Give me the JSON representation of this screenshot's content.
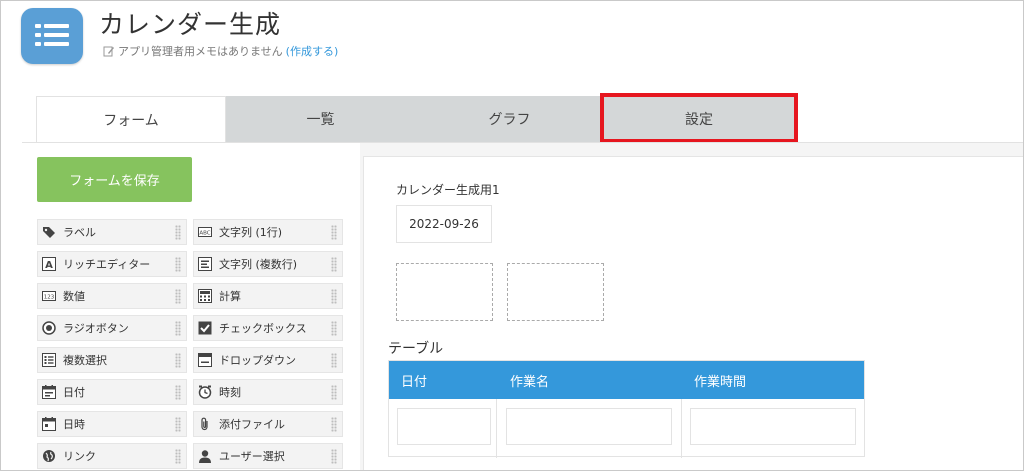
{
  "app": {
    "title": "カレンダー生成",
    "memo_text": "アプリ管理者用メモはありません",
    "memo_link": "(作成する)"
  },
  "tabs": [
    {
      "label": "フォーム",
      "active": true
    },
    {
      "label": "一覧",
      "active": false
    },
    {
      "label": "グラフ",
      "active": false
    },
    {
      "label": "設定",
      "active": false,
      "highlighted": true
    }
  ],
  "palette": {
    "save_label": "フォームを保存",
    "fields": [
      {
        "label": "ラベル",
        "icon": "tag-icon"
      },
      {
        "label": "文字列 (1行)",
        "icon": "abc-text-icon"
      },
      {
        "label": "リッチエディター",
        "icon": "rich-editor-icon"
      },
      {
        "label": "文字列 (複数行)",
        "icon": "multiline-text-icon"
      },
      {
        "label": "数値",
        "icon": "number-icon"
      },
      {
        "label": "計算",
        "icon": "calculator-icon"
      },
      {
        "label": "ラジオボタン",
        "icon": "radio-icon"
      },
      {
        "label": "チェックボックス",
        "icon": "checkbox-icon"
      },
      {
        "label": "複数選択",
        "icon": "multi-select-icon"
      },
      {
        "label": "ドロップダウン",
        "icon": "dropdown-icon"
      },
      {
        "label": "日付",
        "icon": "calendar-icon"
      },
      {
        "label": "時刻",
        "icon": "clock-icon"
      },
      {
        "label": "日時",
        "icon": "datetime-icon"
      },
      {
        "label": "添付ファイル",
        "icon": "paperclip-icon"
      },
      {
        "label": "リンク",
        "icon": "globe-link-icon"
      },
      {
        "label": "ユーザー選択",
        "icon": "user-icon"
      }
    ]
  },
  "canvas": {
    "calendar_field_label": "カレンダー生成用1",
    "calendar_field_value": "2022-09-26",
    "table_label": "テーブル",
    "table_columns": [
      "日付",
      "作業名",
      "作業時間"
    ]
  },
  "colors": {
    "accent": "#3498db",
    "save_button": "#86c35e",
    "highlight": "#e6161f",
    "app_icon": "#5a9fd6"
  }
}
